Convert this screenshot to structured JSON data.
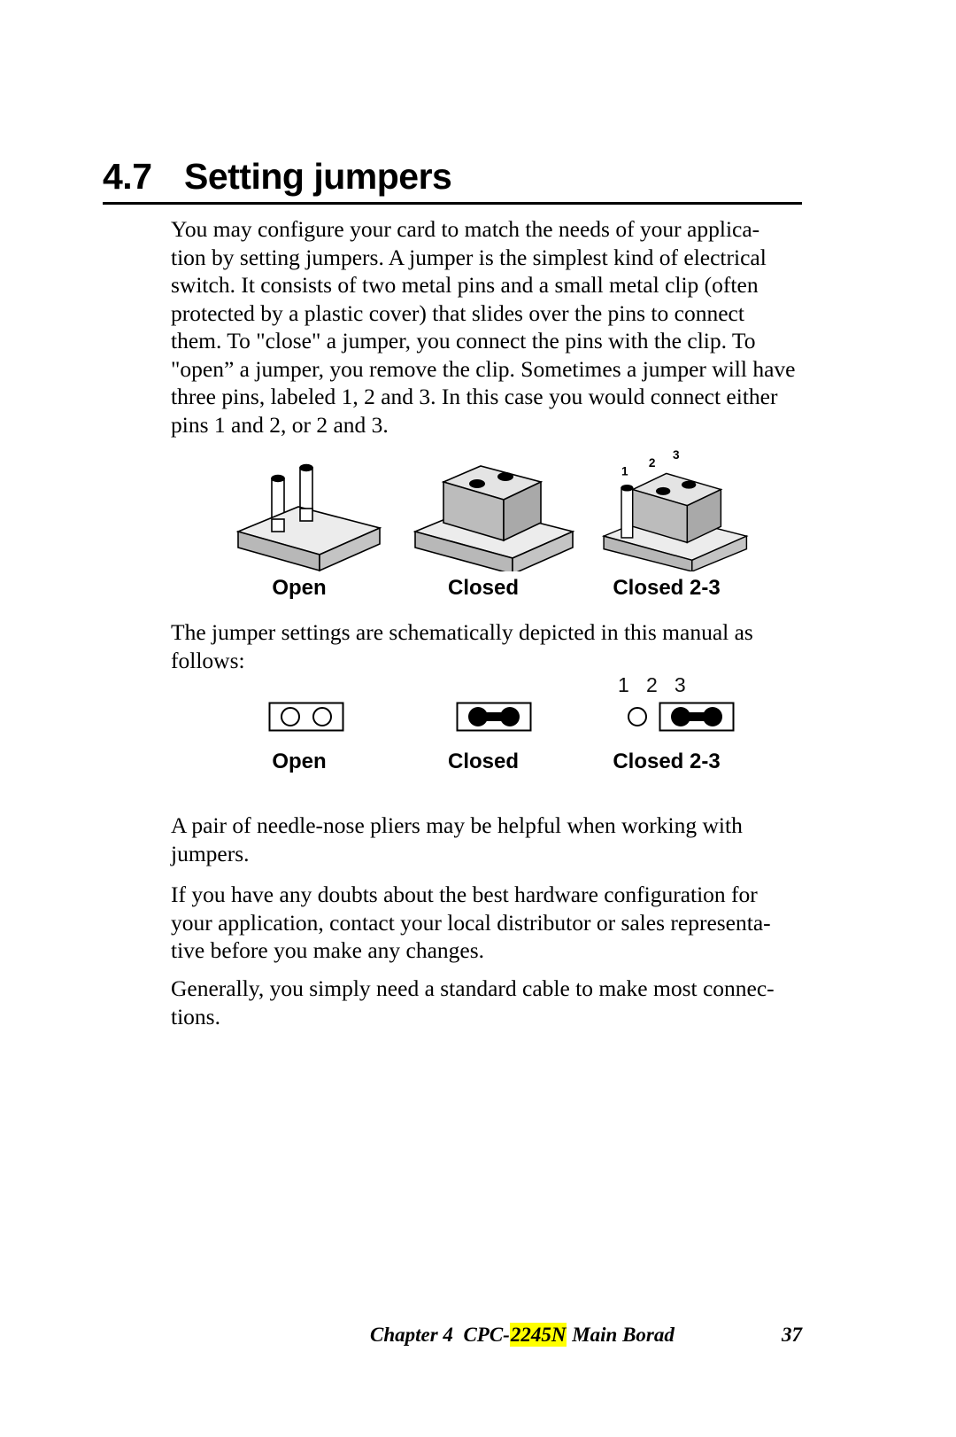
{
  "heading": {
    "number": "4.7",
    "title": "Setting jumpers"
  },
  "paragraphs": {
    "intro": [
      "You may configure your card to match the needs of your applica-",
      "tion by setting jumpers. A jumper is the simplest kind of electrical",
      "switch. It consists of two metal pins and a small metal clip (often",
      "protected by a plastic cover) that slides over the pins to connect",
      "them. To \"close\" a jumper, you connect the pins with the clip. To",
      "\"open” a jumper, you remove the clip. Sometimes a jumper will have",
      "three pins, labeled 1, 2 and 3. In this case you would connect either",
      "pins 1 and 2, or 2 and 3."
    ],
    "schematic_intro": [
      "The jumper settings are schematically depicted in this manual as",
      "follows:"
    ],
    "pliers": [
      "A pair of needle-nose pliers may be helpful when working with",
      "jumpers."
    ],
    "doubts": [
      "If you have any doubts about the best hardware configuration for",
      "your application, contact your local distributor or sales representa-",
      "tive before you make any changes."
    ],
    "general": [
      "Generally, you simply need a standard cable to make most connec-",
      "tions."
    ]
  },
  "figures_3d": {
    "open_label": "Open",
    "closed_label": "Closed",
    "closed23_label": "Closed 2-3",
    "pin_labels": {
      "pin1": "1",
      "pin2": "2",
      "pin3": "3"
    }
  },
  "schematics": {
    "open_label": "Open",
    "closed_label": "Closed",
    "closed23_label": "Closed 2-3",
    "pin_numbers": "1   2   3"
  },
  "footer": {
    "chapter": "Chapter 4",
    "product_prefix": "CPC-",
    "product_highlight": "2245N",
    "product_suffix": " Main Borad",
    "page_number": "37"
  },
  "colors": {
    "highlight": "#ffff00",
    "ink": "#000000",
    "block_top": "#ececec",
    "block_front": "#c0c0c0",
    "block_side": "#b0b0b0"
  }
}
